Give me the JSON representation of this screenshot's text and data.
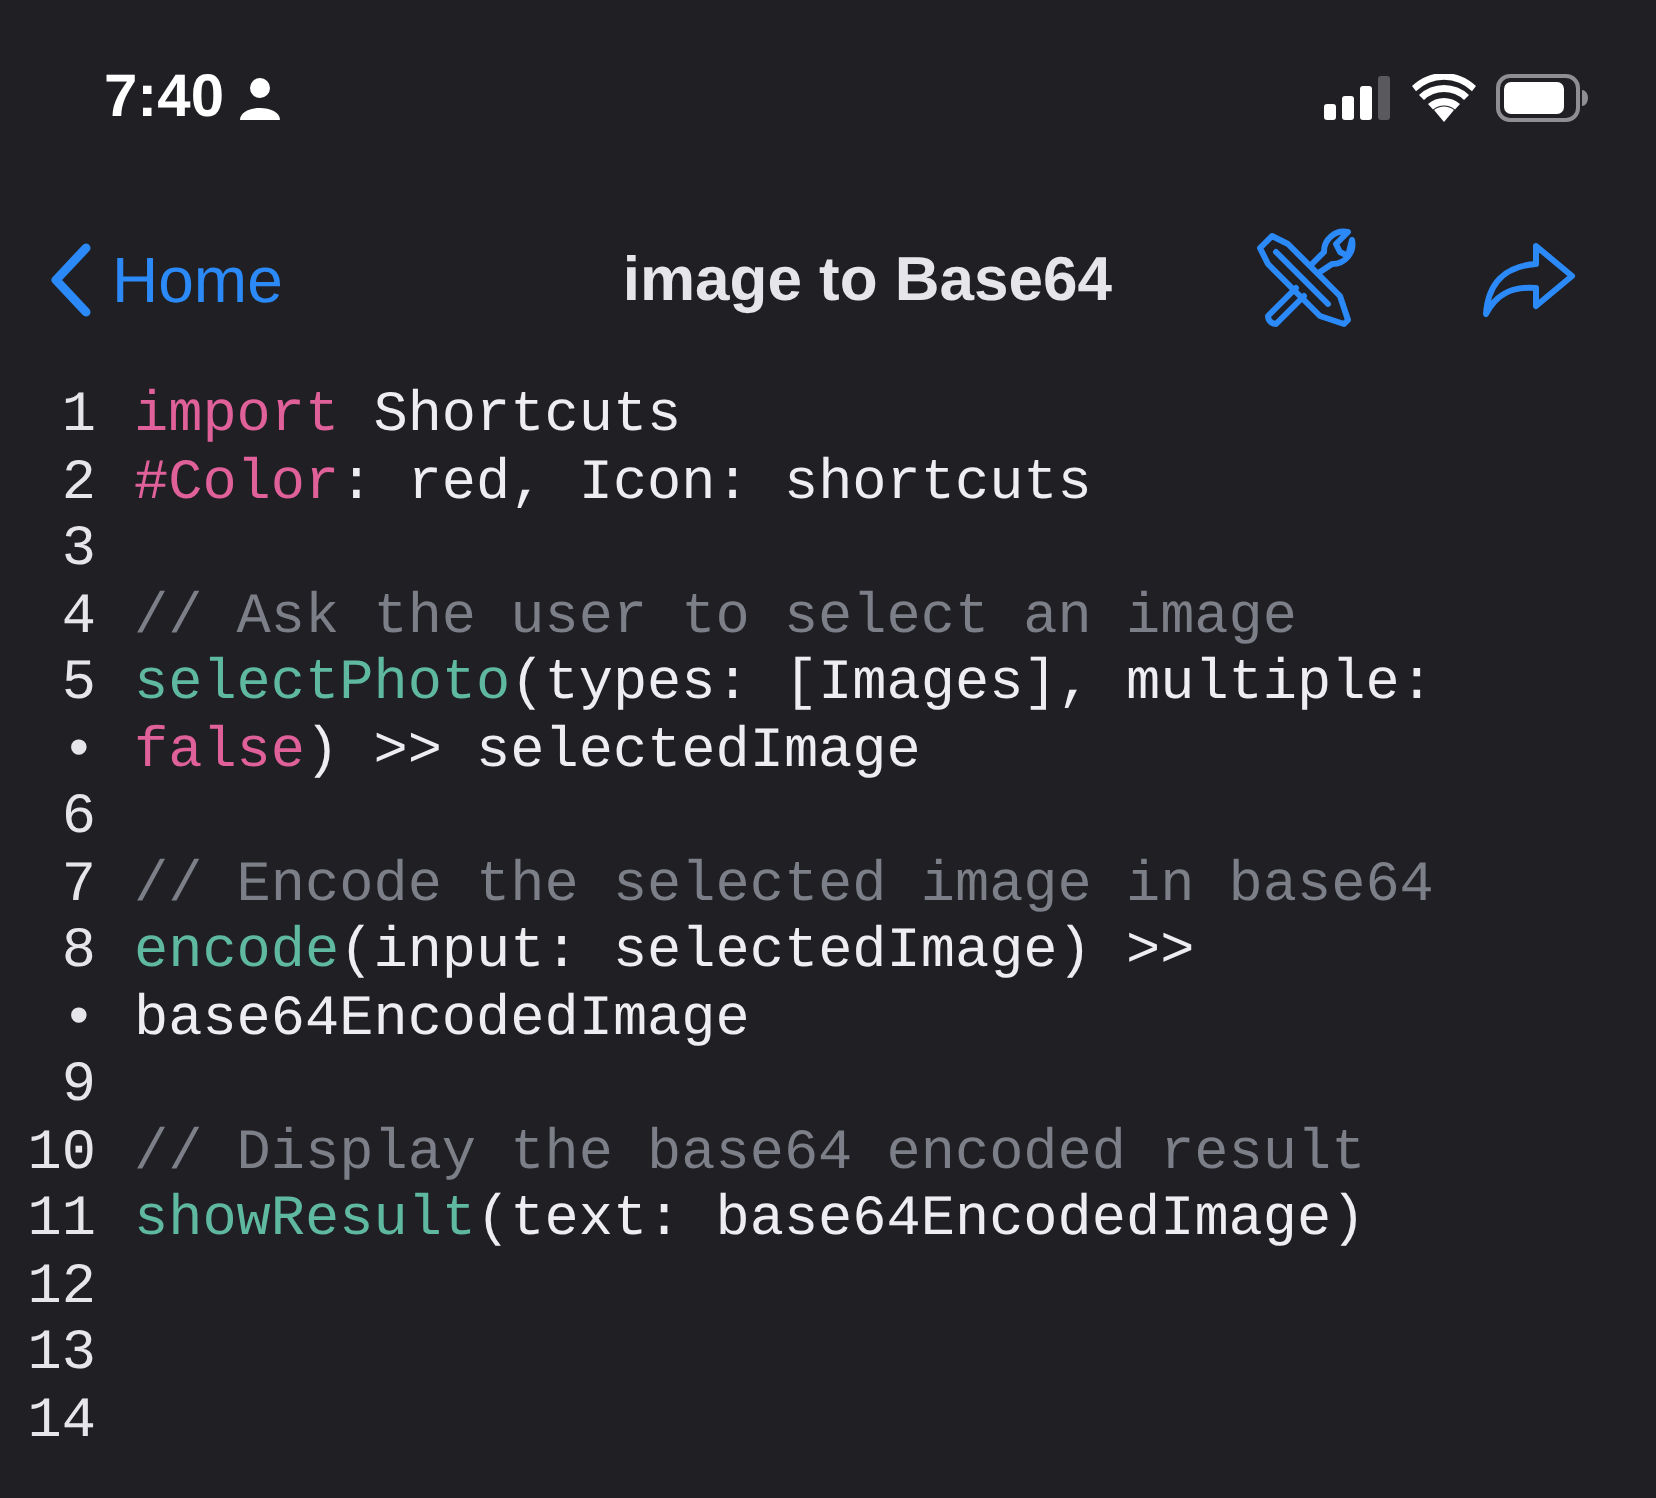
{
  "status_bar": {
    "time": "7:40"
  },
  "nav_bar": {
    "back_label": "Home",
    "title": "image to Base64"
  },
  "editor": {
    "lines": [
      {
        "gutter": "1",
        "tokens": [
          {
            "kind": "keyword",
            "text": "import"
          },
          {
            "kind": "plain",
            "text": " Shortcuts"
          }
        ]
      },
      {
        "gutter": "2",
        "tokens": [
          {
            "kind": "keyword",
            "text": "#Color"
          },
          {
            "kind": "plain",
            "text": ": red, Icon: shortcuts"
          }
        ]
      },
      {
        "gutter": "3"
      },
      {
        "gutter": "4",
        "tokens": [
          {
            "kind": "comment",
            "text": "// Ask the user to select an image"
          }
        ]
      },
      {
        "gutter": "5",
        "tokens": [
          {
            "kind": "function",
            "text": "selectPhoto"
          },
          {
            "kind": "plain",
            "text": "(types: [Images], multiple:"
          }
        ]
      },
      {
        "gutter": "•",
        "tokens": [
          {
            "kind": "keyword",
            "text": "false"
          },
          {
            "kind": "plain",
            "text": ") >> selectedImage"
          }
        ]
      },
      {
        "gutter": "6"
      },
      {
        "gutter": "7",
        "tokens": [
          {
            "kind": "comment",
            "text": "// Encode the selected image in base64"
          }
        ]
      },
      {
        "gutter": "8",
        "tokens": [
          {
            "kind": "function",
            "text": "encode"
          },
          {
            "kind": "plain",
            "text": "(input: selectedImage) >>"
          }
        ]
      },
      {
        "gutter": "•",
        "tokens": [
          {
            "kind": "plain",
            "text": "base64EncodedImage"
          }
        ]
      },
      {
        "gutter": "9"
      },
      {
        "gutter": "10",
        "tokens": [
          {
            "kind": "comment",
            "text": "// Display the base64 encoded result"
          }
        ]
      },
      {
        "gutter": "11",
        "tokens": [
          {
            "kind": "function",
            "text": "showResult"
          },
          {
            "kind": "plain",
            "text": "(text: base64EncodedImage)"
          }
        ]
      },
      {
        "gutter": "12"
      },
      {
        "gutter": "13"
      },
      {
        "gutter": "14"
      }
    ]
  }
}
